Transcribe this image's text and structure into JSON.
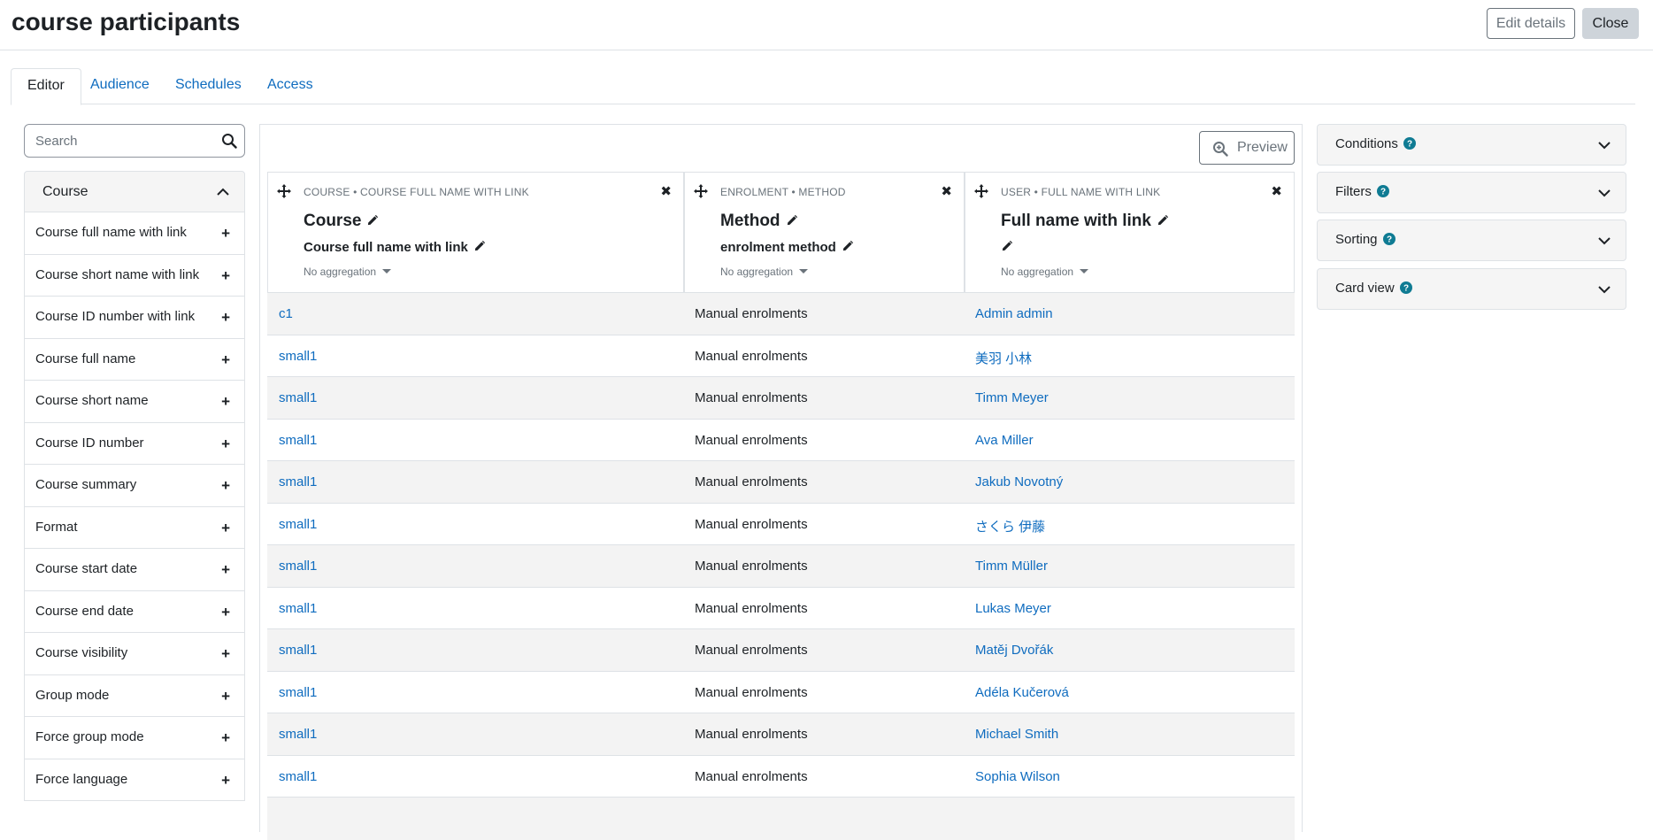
{
  "header": {
    "title": "course participants",
    "edit_label": "Edit details",
    "close_label": "Close"
  },
  "tabs": [
    {
      "label": "Editor",
      "active": true
    },
    {
      "label": "Audience",
      "active": false
    },
    {
      "label": "Schedules",
      "active": false
    },
    {
      "label": "Access",
      "active": false
    }
  ],
  "sidebar": {
    "search_placeholder": "Search",
    "category": "Course",
    "items": [
      "Course full name with link",
      "Course short name with link",
      "Course ID number with link",
      "Course full name",
      "Course short name",
      "Course ID number",
      "Course summary",
      "Format",
      "Course start date",
      "Course end date",
      "Course visibility",
      "Group mode",
      "Force group mode",
      "Force language"
    ]
  },
  "main": {
    "preview_label": "Preview",
    "columns": [
      {
        "caption": "COURSE • COURSE FULL NAME WITH LINK",
        "name": "Course",
        "sub": "Course full name with link",
        "aggregation": "No aggregation"
      },
      {
        "caption": "ENROLMENT • METHOD",
        "name": "Method",
        "sub": "enrolment method",
        "aggregation": "No aggregation"
      },
      {
        "caption": "USER • FULL NAME WITH LINK",
        "name": "Full name with link",
        "sub": "",
        "aggregation": "No aggregation"
      }
    ],
    "rows": [
      [
        "c1",
        "Manual enrolments",
        "Admin admin"
      ],
      [
        "small1",
        "Manual enrolments",
        "美羽 小林"
      ],
      [
        "small1",
        "Manual enrolments",
        "Timm Meyer"
      ],
      [
        "small1",
        "Manual enrolments",
        "Ava Miller"
      ],
      [
        "small1",
        "Manual enrolments",
        "Jakub Novotný"
      ],
      [
        "small1",
        "Manual enrolments",
        "さくら 伊藤"
      ],
      [
        "small1",
        "Manual enrolments",
        "Timm Müller"
      ],
      [
        "small1",
        "Manual enrolments",
        "Lukas Meyer"
      ],
      [
        "small1",
        "Manual enrolments",
        "Matěj Dvořák"
      ],
      [
        "small1",
        "Manual enrolments",
        "Adéla Kučerová"
      ],
      [
        "small1",
        "Manual enrolments",
        "Michael Smith"
      ],
      [
        "small1",
        "Manual enrolments",
        "Sophia Wilson"
      ]
    ]
  },
  "settings": {
    "panels": [
      "Conditions",
      "Filters",
      "Sorting",
      "Card view"
    ]
  },
  "colors": {
    "link": "#0f6cbf",
    "help_icon": "#0f7b93",
    "border": "#dee2e6",
    "stripe": "#f3f3f3"
  }
}
